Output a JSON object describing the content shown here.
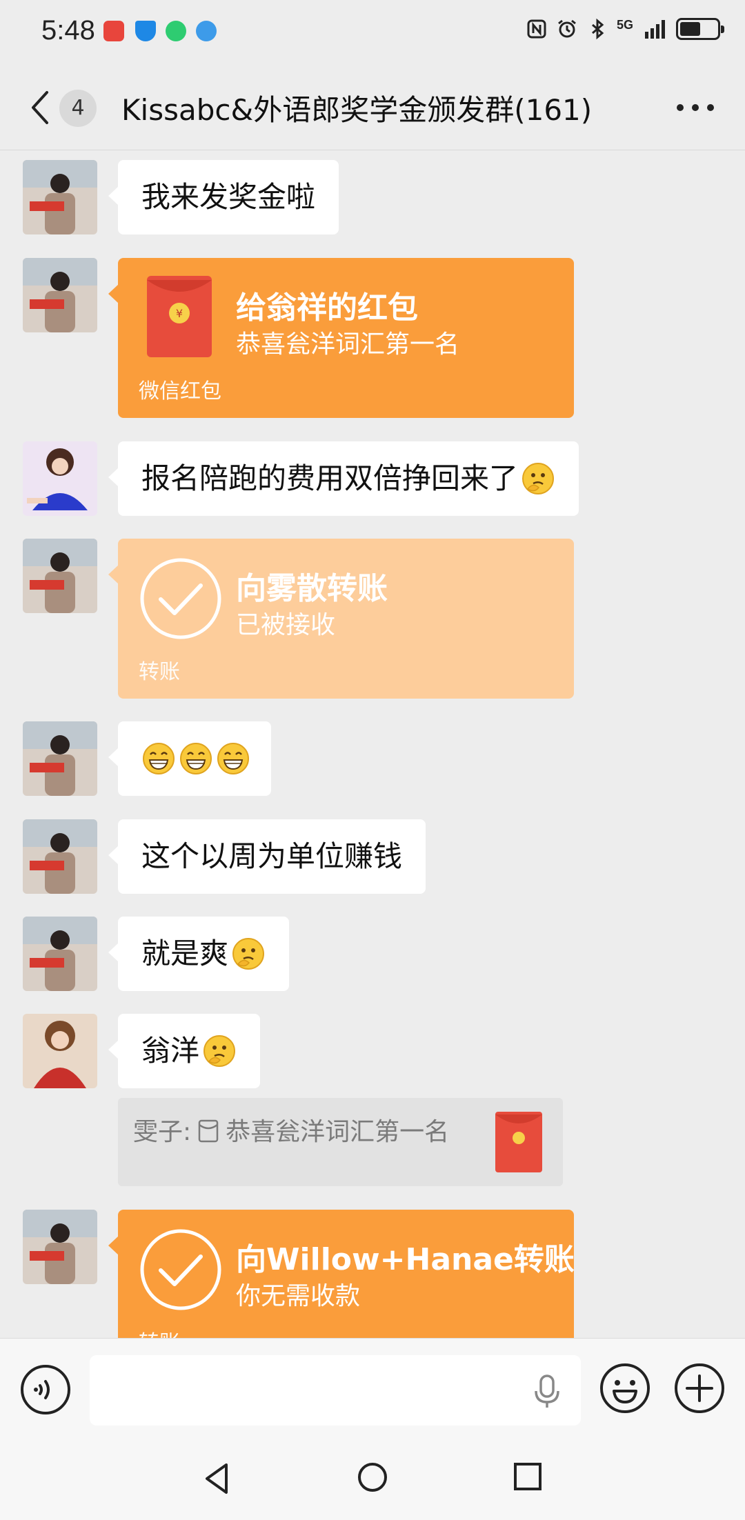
{
  "status_bar": {
    "time": "5:48",
    "network": "5G",
    "battery_level": 0.55
  },
  "header": {
    "unread_count": "4",
    "title": "Kissabc&外语郎奖学金颁发群(161)"
  },
  "messages": {
    "m1": {
      "text": "我来发奖金啦"
    },
    "m2": {
      "title": "给翁祥的红包",
      "subtitle": "恭喜瓮洋词汇第一名",
      "footer": "微信红包"
    },
    "m3": {
      "text": "报名陪跑的费用双倍挣回来了",
      "emoji": "thinking-emoji"
    },
    "m4": {
      "title": "向雾散转账",
      "subtitle": "已被接收",
      "footer": "转账"
    },
    "m5": {
      "emoji": "grin-emoji",
      "count": 3
    },
    "m6": {
      "text": "这个以周为单位赚钱"
    },
    "m7": {
      "text": "就是爽",
      "emoji": "thinking-emoji"
    },
    "m8": {
      "text": "翁洋",
      "emoji": "thinking-emoji",
      "quote_sender": "雯子:",
      "quote_text": "恭喜瓮洋词汇第一名"
    },
    "m9": {
      "title": "向Willow+Hanae转账",
      "subtitle": "你无需收款",
      "footer": "转账"
    }
  },
  "colors": {
    "accent_orange": "#fa9d3b",
    "accepted_orange": "#fdcd9b",
    "red_packet": "#e74c3c",
    "background": "#ededed"
  }
}
